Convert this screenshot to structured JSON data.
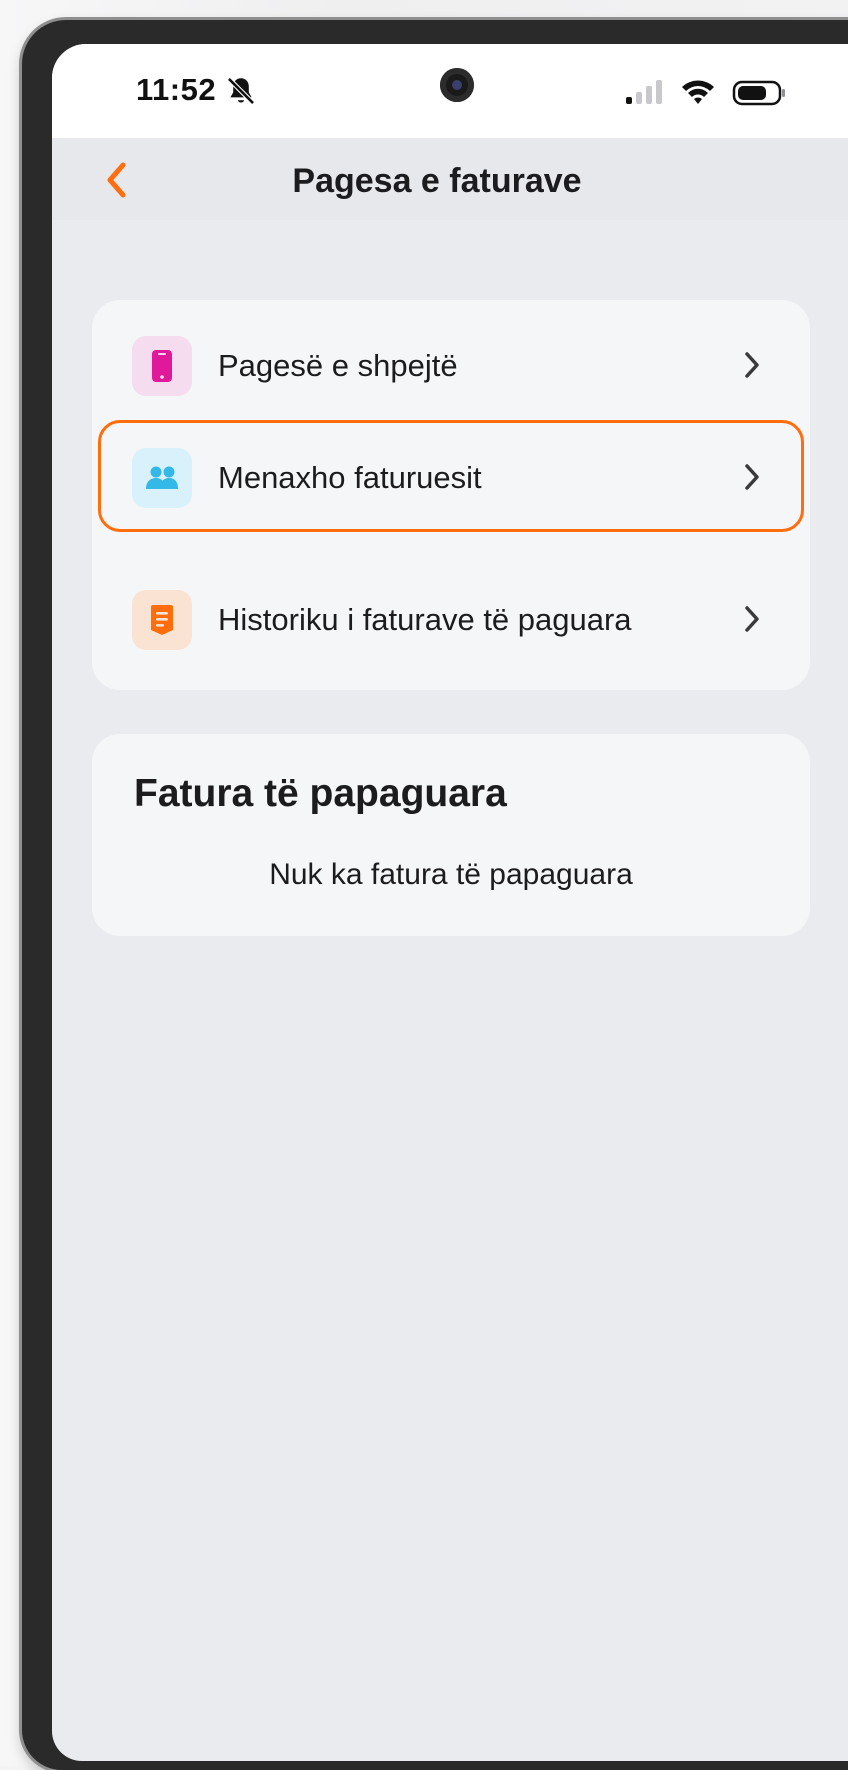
{
  "status_bar": {
    "time": "11:52",
    "icons": [
      "bell-slash-icon",
      "camera-icon",
      "signal-icon",
      "wifi-icon",
      "battery-icon"
    ]
  },
  "header": {
    "title": "Pagesa e faturave",
    "back_icon": "chevron-left-icon"
  },
  "menu": {
    "items": [
      {
        "label": "Pagesë e shpejtë",
        "icon": "phone-icon",
        "icon_color": "#e0189a",
        "icon_bg": "#f5dcef",
        "highlighted": false
      },
      {
        "label": "Menaxho faturuesit",
        "icon": "people-icon",
        "icon_color": "#33b8e8",
        "icon_bg": "#d9f1fb",
        "highlighted": true
      },
      {
        "label": "Historiku i faturave të paguara",
        "icon": "receipt-icon",
        "icon_color": "#ff6d0c",
        "icon_bg": "#fbe3d4",
        "highlighted": false
      }
    ]
  },
  "unpaid": {
    "title": "Fatura të papaguara",
    "empty_message": "Nuk ka fatura të papaguara"
  },
  "colors": {
    "accent": "#ff6d0c",
    "background": "#e9ebef",
    "card": "#f5f6f7"
  }
}
